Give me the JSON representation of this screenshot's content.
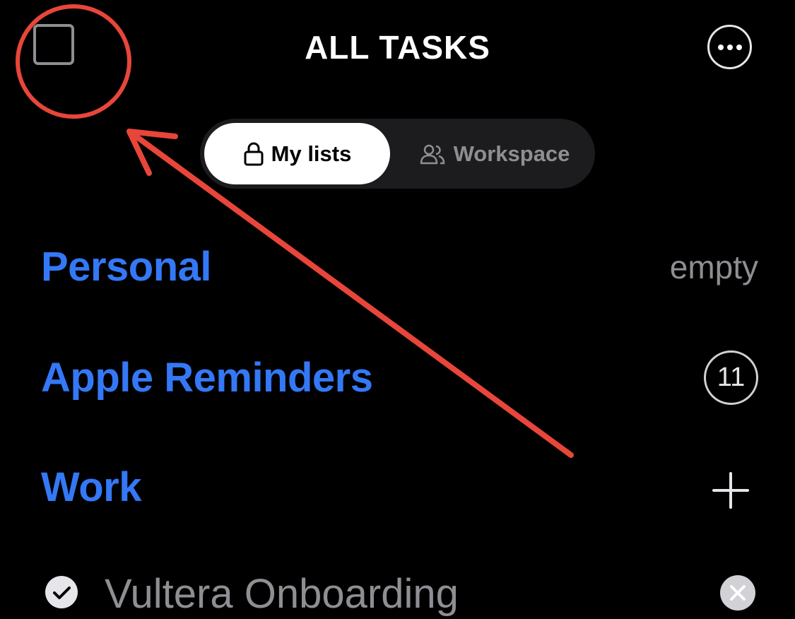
{
  "header": {
    "title": "ALL TASKS",
    "sidebar_toggle_icon": "sidebar-square-icon",
    "more_icon": "ellipsis-circle-icon"
  },
  "segmented": {
    "options": [
      {
        "label": "My lists",
        "icon": "lock-icon",
        "selected": true
      },
      {
        "label": "Workspace",
        "icon": "people-icon",
        "selected": false
      }
    ]
  },
  "lists": [
    {
      "title": "Personal",
      "status": "empty"
    },
    {
      "title": "Apple Reminders",
      "count": "11"
    },
    {
      "title": "Work",
      "action_icon": "plus-icon"
    }
  ],
  "tasks": [
    {
      "title": "Vultera Onboarding",
      "completed": true
    }
  ],
  "colors": {
    "background": "#000000",
    "accent": "#3478f6",
    "secondary_text": "#8e8e93",
    "annotation": "#e8463a"
  }
}
